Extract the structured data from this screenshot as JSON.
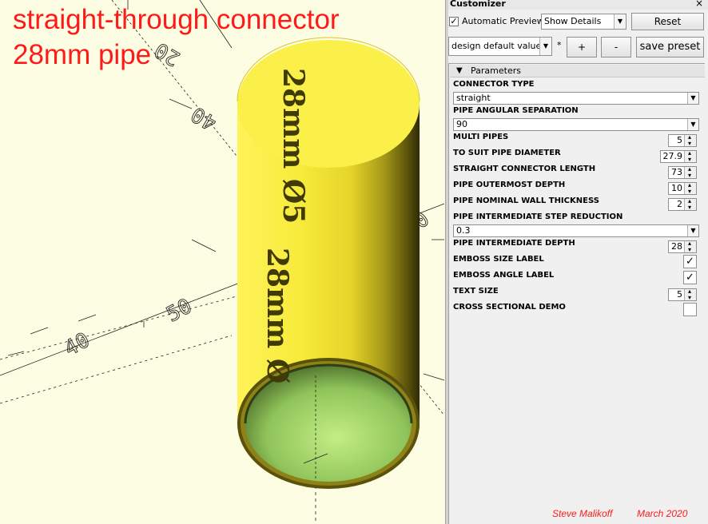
{
  "overlay": {
    "line1": "straight-through connector",
    "line2": "28mm pipe"
  },
  "model": {
    "emboss_size": "28mm Ø",
    "emboss_angle": "28mm Ø5",
    "axis_labels": [
      "20",
      "40",
      "50",
      "40",
      "50"
    ],
    "colors": {
      "body": "#f5e93c",
      "shadow": "#6b6010",
      "inner": "#a8d86a",
      "background": "#fdfde3"
    }
  },
  "customizer": {
    "title": "Customizer",
    "close": "×",
    "auto_preview": {
      "label": "Automatic Preview",
      "checked": "✓"
    },
    "details_select": "Show Details",
    "reset": "Reset",
    "preset_select": "design default values",
    "preset_star": "*",
    "add": "+",
    "remove": "-",
    "save_preset": "save preset",
    "parameters_label": "Parameters",
    "params": [
      {
        "label": "CONNECTOR TYPE",
        "type": "combo",
        "value": "straight"
      },
      {
        "label": "PIPE ANGULAR SEPARATION",
        "type": "combo",
        "value": "90"
      },
      {
        "label": "MULTI PIPES",
        "type": "spin",
        "value": "5"
      },
      {
        "label": "TO SUIT PIPE DIAMETER",
        "type": "spin",
        "value": "27.9"
      },
      {
        "label": "STRAIGHT CONNECTOR LENGTH",
        "type": "spin",
        "value": "73"
      },
      {
        "label": "PIPE OUTERMOST DEPTH",
        "type": "spin",
        "value": "10"
      },
      {
        "label": "PIPE NOMINAL WALL THICKNESS",
        "type": "spin",
        "value": "2"
      },
      {
        "label": "PIPE INTERMEDIATE STEP REDUCTION",
        "type": "combo",
        "value": "0.3"
      },
      {
        "label": "PIPE INTERMEDIATE DEPTH",
        "type": "spin",
        "value": "28"
      },
      {
        "label": "EMBOSS SIZE LABEL",
        "type": "check",
        "value": "✓"
      },
      {
        "label": "EMBOSS ANGLE LABEL",
        "type": "check",
        "value": "✓"
      },
      {
        "label": "TEXT SIZE",
        "type": "spin",
        "value": "5"
      },
      {
        "label": "CROSS SECTIONAL DEMO",
        "type": "check",
        "value": ""
      }
    ],
    "credit_author": "Steve Malikoff",
    "credit_date": "March 2020"
  }
}
